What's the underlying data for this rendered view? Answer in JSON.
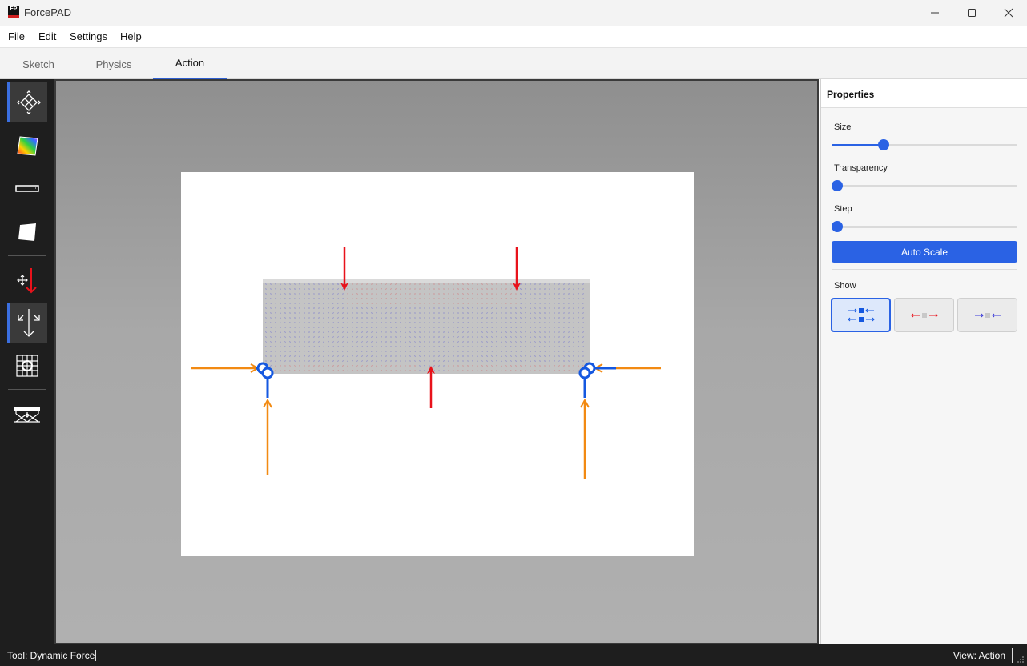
{
  "window": {
    "title": "ForcePAD",
    "icon_label": "FP",
    "controls": [
      "minimize-icon",
      "maximize-icon",
      "close-icon"
    ]
  },
  "menu": {
    "items": [
      {
        "label": "File"
      },
      {
        "label": "Edit"
      },
      {
        "label": "Settings"
      },
      {
        "label": "Help"
      }
    ]
  },
  "tabs": {
    "items": [
      {
        "label": "Sketch"
      },
      {
        "label": "Physics"
      },
      {
        "label": "Action"
      }
    ],
    "active": "Action"
  },
  "toolbox": {
    "tools": [
      {
        "icon": "move-view-icon",
        "selected": true
      },
      {
        "icon": "color-gradient-icon",
        "selected": false
      },
      {
        "icon": "beam-dimension-icon",
        "selected": false
      },
      {
        "icon": "rotate-square-icon",
        "selected": false
      },
      {
        "icon": "move-force-icon",
        "selected": false
      },
      {
        "icon": "dynamic-force-icon",
        "selected": true
      },
      {
        "icon": "grid-target-icon",
        "selected": false
      },
      {
        "icon": "structure-load-icon",
        "selected": false
      }
    ]
  },
  "canvas": {
    "colors": {
      "force": "#e8121b",
      "reaction": "#f28a12",
      "support": "#1558e0",
      "stress_field": "#3a3ad8",
      "beam": "#c4c4c4"
    }
  },
  "properties": {
    "title": "Properties",
    "size": {
      "label": "Size",
      "value": 0.28
    },
    "transparency": {
      "label": "Transparency",
      "value": 0.03
    },
    "step": {
      "label": "Step",
      "value": 0.03
    },
    "auto_scale_label": "Auto Scale",
    "show": {
      "label": "Show",
      "options": [
        {
          "icon": "all-forces-icon",
          "active": true
        },
        {
          "icon": "tension-icon",
          "active": false
        },
        {
          "icon": "compression-icon",
          "active": false
        }
      ]
    },
    "accent_color": "#2a62e4"
  },
  "status": {
    "tool": "Tool: Dynamic Force",
    "view": "View: Action"
  }
}
